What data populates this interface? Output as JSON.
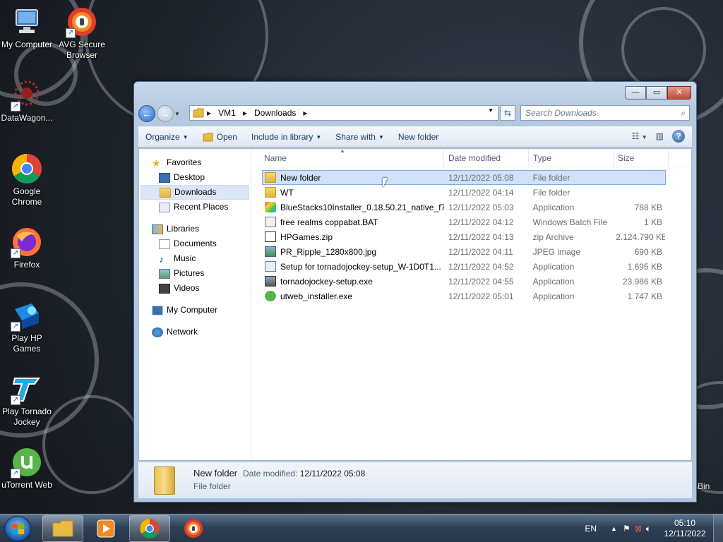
{
  "desktop": {
    "icons": [
      {
        "label": "My Computer",
        "icon": "computer-icon"
      },
      {
        "label": "AVG Secure Browser",
        "icon": "avg-browser-icon"
      },
      {
        "label": "DataWagon...",
        "icon": "datawagon-icon"
      },
      {
        "label": "Google Chrome",
        "icon": "chrome-icon"
      },
      {
        "label": "Firefox",
        "icon": "firefox-icon"
      },
      {
        "label": "Play HP Games",
        "icon": "hp-games-icon"
      },
      {
        "label": "Play Tornado Jockey",
        "icon": "tornado-jockey-icon"
      },
      {
        "label": "uTorrent Web",
        "icon": "utorrent-icon"
      }
    ],
    "recycle_bin_partial": "Bin"
  },
  "window": {
    "controls": {
      "minimize": "—",
      "maximize": "▭",
      "close": "✕"
    },
    "address": {
      "segments": [
        "VM1",
        "Downloads"
      ]
    },
    "search_placeholder": "Search Downloads",
    "toolbar": {
      "organize": "Organize",
      "open": "Open",
      "include": "Include in library",
      "share": "Share with",
      "new_folder": "New folder"
    },
    "nav": {
      "favorites": "Favorites",
      "desktop": "Desktop",
      "downloads": "Downloads",
      "recent": "Recent Places",
      "libraries": "Libraries",
      "documents": "Documents",
      "music": "Music",
      "pictures": "Pictures",
      "videos": "Videos",
      "computer": "My Computer",
      "network": "Network"
    },
    "columns": {
      "name": "Name",
      "date": "Date modified",
      "type": "Type",
      "size": "Size"
    },
    "files": [
      {
        "name": "New folder",
        "date": "12/11/2022 05:08",
        "type": "File folder",
        "size": "",
        "icon": "folder-icon"
      },
      {
        "name": "WT",
        "date": "12/11/2022 04:14",
        "type": "File folder",
        "size": "",
        "icon": "folder-icon"
      },
      {
        "name": "BlueStacks10Installer_0.18.50.21_native_f7...",
        "date": "12/11/2022 05:03",
        "type": "Application",
        "size": "788 KB",
        "icon": "bluestacks-icon"
      },
      {
        "name": "free realms coppabat.BAT",
        "date": "12/11/2022 04:12",
        "type": "Windows Batch File",
        "size": "1 KB",
        "icon": "batch-file-icon"
      },
      {
        "name": "HPGames.zip",
        "date": "12/11/2022 04:13",
        "type": "zip Archive",
        "size": "2.124.790 KB",
        "icon": "zip-icon"
      },
      {
        "name": "PR_Ripple_1280x800.jpg",
        "date": "12/11/2022 04:11",
        "type": "JPEG image",
        "size": "690 KB",
        "icon": "image-file-icon"
      },
      {
        "name": "Setup for tornadojockey-setup_W-1D0T1...",
        "date": "12/11/2022 04:52",
        "type": "Application",
        "size": "1.695 KB",
        "icon": "installer-icon"
      },
      {
        "name": "tornadojockey-setup.exe",
        "date": "12/11/2022 04:55",
        "type": "Application",
        "size": "23.986 KB",
        "icon": "setup-exe-icon"
      },
      {
        "name": "utweb_installer.exe",
        "date": "12/11/2022 05:01",
        "type": "Application",
        "size": "1.747 KB",
        "icon": "utorrent-icon"
      }
    ],
    "details": {
      "name": "New folder",
      "date_label": "Date modified:",
      "date_value": "12/11/2022 05:08",
      "type": "File folder"
    }
  },
  "taskbar": {
    "lang": "EN",
    "time": "05:10",
    "date": "12/11/2022"
  }
}
